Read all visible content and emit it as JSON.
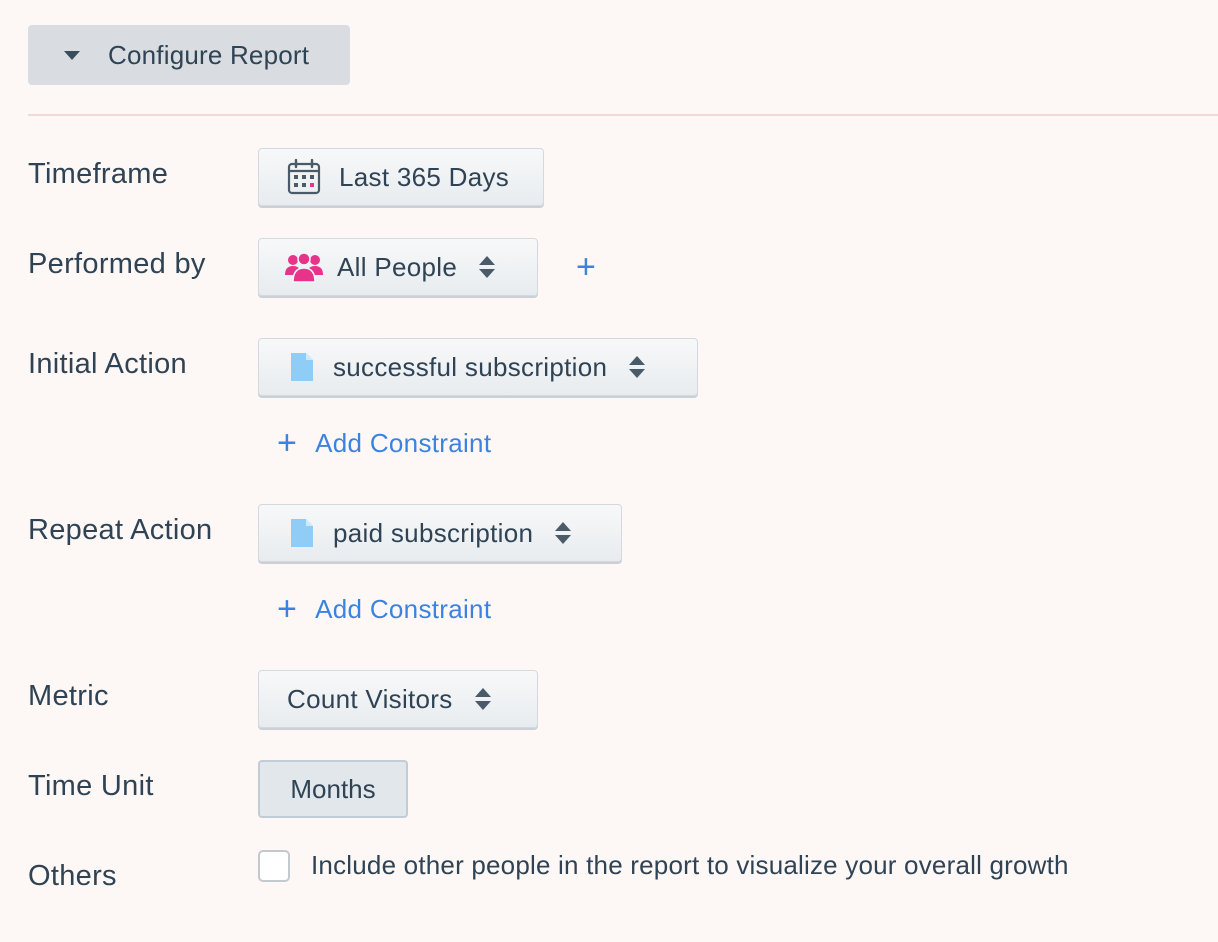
{
  "header": {
    "configure_label": "Configure Report"
  },
  "rows": {
    "timeframe": {
      "label": "Timeframe",
      "value": "Last 365 Days",
      "icon": "calendar-icon"
    },
    "performed_by": {
      "label": "Performed by",
      "value": "All People",
      "icon": "people-group-icon",
      "icon_color": "#e8338b",
      "add_symbol": "+"
    },
    "initial_action": {
      "label": "Initial Action",
      "value": "successful subscription",
      "icon": "document-icon",
      "add_constraint": "Add Constraint"
    },
    "repeat_action": {
      "label": "Repeat Action",
      "value": "paid subscription",
      "icon": "document-icon",
      "add_constraint": "Add Constraint"
    },
    "metric": {
      "label": "Metric",
      "value": "Count Visitors"
    },
    "time_unit": {
      "label": "Time Unit",
      "value": "Months"
    },
    "others": {
      "label": "Others",
      "checkbox_label": "Include other people in the report to visualize your overall growth",
      "checked": false
    }
  },
  "colors": {
    "accent": "#3b83e0",
    "text": "#2f4354",
    "background": "#fdf8f6",
    "document_icon": "#8fcdf7"
  }
}
